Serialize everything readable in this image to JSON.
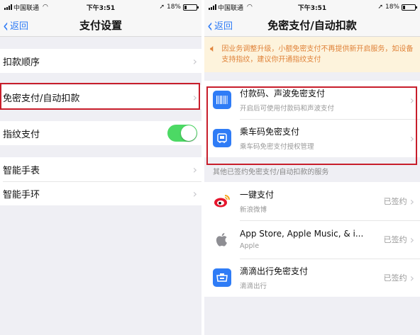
{
  "status_bar": {
    "carrier": "中国联通",
    "time": "下午3:51",
    "battery": "18%",
    "battery_level": 0.18
  },
  "left": {
    "nav": {
      "back_label": "返回",
      "title": "支付设置"
    },
    "rows": {
      "deduct_order": "扣款顺序",
      "password_free": "免密支付/自动扣款",
      "fingerprint": "指纹支付",
      "smart_watch": "智能手表",
      "smart_band": "智能手环"
    },
    "fingerprint_enabled": true
  },
  "right": {
    "nav": {
      "back_label": "返回",
      "title": "免密支付/自动扣款"
    },
    "notice": "因业务调整升级，小额免密支付不再提供新开启服务，如设备支持指纹，建议你开通指纹支付",
    "featured": [
      {
        "title": "付款码、声波免密支付",
        "subtitle": "开启后可使用付款码和声波支付",
        "icon": "barcode-icon"
      },
      {
        "title": "乘车码免密支付",
        "subtitle": "乘车码免密支付授权管理",
        "icon": "bus-code-icon"
      }
    ],
    "section_header": "其他已签约免密支付/自动扣款的服务",
    "services": [
      {
        "title": "一键支付",
        "subtitle": "新浪微博",
        "status": "已签约",
        "icon": "weibo-icon"
      },
      {
        "title": "App Store, Apple Music, & i...",
        "subtitle": "Apple",
        "status": "已签约",
        "icon": "apple-icon"
      },
      {
        "title": "滴滴出行免密支付",
        "subtitle": "滴滴出行",
        "status": "已签约",
        "icon": "didi-icon"
      }
    ]
  },
  "colors": {
    "accent": "#2f7cf6",
    "highlight_border": "#c81e2b",
    "toggle_on": "#4cd964",
    "notice_text": "#e0833a",
    "notice_bg": "#fdf3dc"
  }
}
